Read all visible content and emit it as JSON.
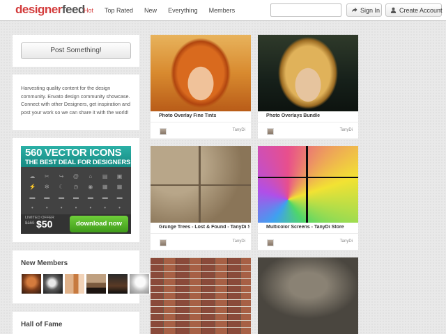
{
  "header": {
    "logo_part1": "designer",
    "logo_part2": "feed",
    "nav": [
      "Hot",
      "Top Rated",
      "New",
      "Everything",
      "Members"
    ],
    "active_nav": "Hot",
    "search": {
      "value": "",
      "placeholder": ""
    },
    "sign_in_label": "Sign In",
    "create_account_label": "Create Account"
  },
  "sidebar": {
    "post_button_label": "Post Something!",
    "about_text": "Harvesting quality content for the design community. Envato design community showcase. Connect with other Designers, get inspiration and post your work so we can share it with the world!",
    "ad": {
      "line1": "560 VECTOR ICONS",
      "line2": "THE BEST DEAL FOR DESIGNERS",
      "limited_label": "LIMITED OFFER",
      "old_price": "$160",
      "new_price": "$50",
      "cta_label": "download now"
    },
    "new_members_title": "New Members",
    "hall_of_fame_title": "Hall of Fame"
  },
  "feed": [
    {
      "title": "Photo Overlay Fine Tints",
      "author": "TanyDi"
    },
    {
      "title": "Photo Overlays Bundle",
      "author": "TanyDi"
    },
    {
      "title": "Grunge Trees - Lost & Found - TanyDi Store",
      "author": "TanyDi"
    },
    {
      "title": "Multicolor Screens - TanyDi Store",
      "author": "TanyDi"
    },
    {
      "title": "",
      "author": ""
    },
    {
      "title": "",
      "author": ""
    }
  ],
  "colors": {
    "brand_red": "#d33b3b",
    "ad_teal": "#1f9e95",
    "ad_green": "#4fae24"
  },
  "icons": [
    "signin-arrow-icon",
    "user-icon"
  ]
}
